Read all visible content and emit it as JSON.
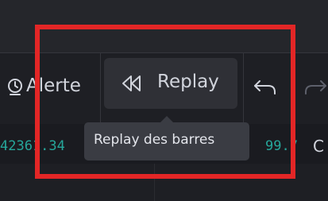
{
  "toolbar": {
    "alert": {
      "label": "Alerte",
      "icon": "alert-clock-icon"
    },
    "replay": {
      "label": "Replay",
      "icon": "rewind-icon"
    },
    "undo": {
      "icon": "undo-icon"
    },
    "redo": {
      "icon": "redo-icon"
    }
  },
  "ticker": {
    "left_value": "42361.34",
    "right_value": "99.7",
    "right_letter": "C"
  },
  "tooltip": {
    "text": "Replay des barres"
  },
  "colors": {
    "background": "#1e1f24",
    "text": "#d1d4dc",
    "price_green": "#26a69a",
    "highlight_red": "#e32626",
    "tooltip_bg": "#3a3c43"
  }
}
